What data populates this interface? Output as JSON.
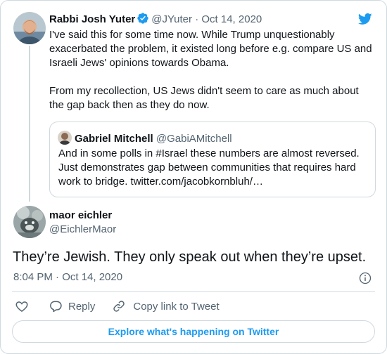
{
  "parent_tweet": {
    "author_name": "Rabbi Josh Yuter",
    "handle": "@JYuter",
    "separator": "·",
    "date": "Oct 14, 2020",
    "paragraphs": [
      "I've said this for some time now. While Trump unquestionably exacerbated the problem, it existed long before e.g. compare US and Israeli Jews' opinions towards Obama.",
      "From my recollection, US Jews didn't seem to care as much about the gap back then as they do now."
    ]
  },
  "quoted_tweet": {
    "author_name": "Gabriel Mitchell",
    "handle": "@GabiAMitchell",
    "text": "And in some polls in #Israel these numbers are almost reversed. Just demonstrates gap between communities that requires hard work to bridge. twitter.com/jacobkornbluh/…"
  },
  "main_tweet": {
    "author_name": "maor eichler",
    "handle": "@EichlerMaor",
    "text": "They’re Jewish. They only speak out when they’re upset.",
    "timestamp": "8:04 PM · Oct 14, 2020"
  },
  "actions": {
    "reply_label": "Reply",
    "copy_link_label": "Copy link to Tweet"
  },
  "explore_label": "Explore what's happening on Twitter",
  "icons": {
    "brand": "twitter-bird-icon",
    "verified": "verified-badge-icon",
    "info": "info-icon",
    "like": "heart-icon",
    "reply": "reply-icon",
    "copy_link": "link-icon"
  },
  "colors": {
    "accent": "#1d9bf0",
    "text": "#0f1419",
    "muted": "#536471",
    "border": "#cfd9de"
  }
}
